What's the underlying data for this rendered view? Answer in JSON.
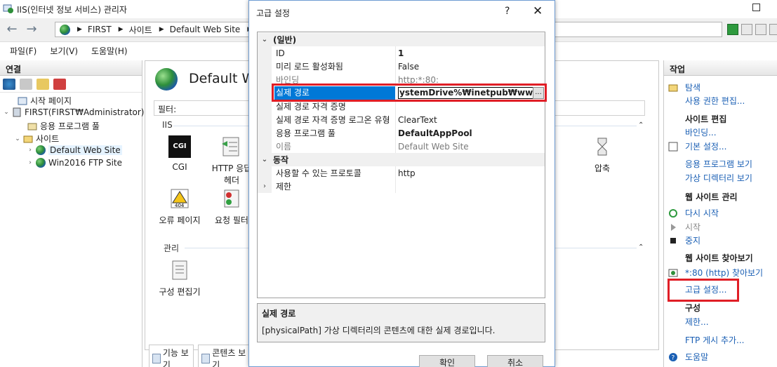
{
  "window": {
    "title": "IIS(인터넷 정보 서비스) 관리자"
  },
  "address": {
    "crumbs": [
      "FIRST",
      "사이트",
      "Default Web Site"
    ]
  },
  "menu": [
    "파일(F)",
    "보기(V)",
    "도움말(H)"
  ],
  "connections": {
    "header": "연결",
    "tree": {
      "start": "시작 페이지",
      "server": "FIRST(FIRST₩Administrator)",
      "apppools": "응용 프로그램 풀",
      "sites": "사이트",
      "site1": "Default Web Site",
      "site2": "Win2016 FTP Site"
    }
  },
  "center": {
    "title": "Default W",
    "filter_label": "필터:",
    "group_iis": "IIS",
    "group_mgmt": "관리",
    "features": {
      "cgi": "CGI",
      "http_line1": "HTTP 응답",
      "http_line2": "헤더",
      "compress": "압축",
      "errpage": "오류 페이지",
      "reqfilter": "요청 필터",
      "configed": "구성 편집기"
    },
    "tabs": {
      "features": "기능 보기",
      "content": "콘텐츠 보기"
    },
    "cgi_icon_text": "CGI"
  },
  "actions": {
    "header": "작업",
    "explore": "탐색",
    "edit_perm": "사용 권한 편집...",
    "site_edit": "사이트 편집",
    "bindings": "바인딩...",
    "basic_settings": "기본 설정...",
    "view_apps": "응용 프로그램 보기",
    "view_vdirs": "가상 디렉터리 보기",
    "manage_site": "웹 사이트 관리",
    "restart": "다시 시작",
    "start": "시작",
    "stop": "중지",
    "browse_site": "웹 사이트 찾아보기",
    "browse_80": "*:80 (http) 찾아보기",
    "advanced": "고급 설정...",
    "config": "구성",
    "limits": "제한...",
    "add_ftp": "FTP 게시 추가...",
    "help": "도움말"
  },
  "dialog": {
    "title": "고급 설정",
    "help_glyph": "?",
    "close_glyph": "✕",
    "cat_general": "(일반)",
    "cat_behavior": "동작",
    "rows": {
      "id": {
        "name": "ID",
        "value": "1"
      },
      "preload": {
        "name": "미리 로드 활성화됨",
        "value": "False"
      },
      "bindings": {
        "name": "바인딩",
        "value": "http:*:80:"
      },
      "physpath": {
        "name": "실제 경로",
        "value": "ystemDrive%₩inetpub₩wwwroot"
      },
      "physcred": {
        "name": "실제 경로 자격 증명",
        "value": ""
      },
      "physcredtype": {
        "name": "실제 경로 자격 증명 로그온 유형",
        "value": "ClearText"
      },
      "apppool": {
        "name": "응용 프로그램 풀",
        "value": "DefaultAppPool"
      },
      "name": {
        "name": "이름",
        "value": "Default Web Site"
      },
      "protocols": {
        "name": "사용할 수 있는 프로토콜",
        "value": "http"
      },
      "limits": {
        "name": "제한",
        "value": ""
      }
    },
    "ellipsis_btn": "...",
    "desc_title": "실제 경로",
    "desc_text": "[physicalPath] 가상 디렉터리의 콘텐츠에 대한 실제 경로입니다.",
    "ok": "확인",
    "cancel": "취소"
  }
}
